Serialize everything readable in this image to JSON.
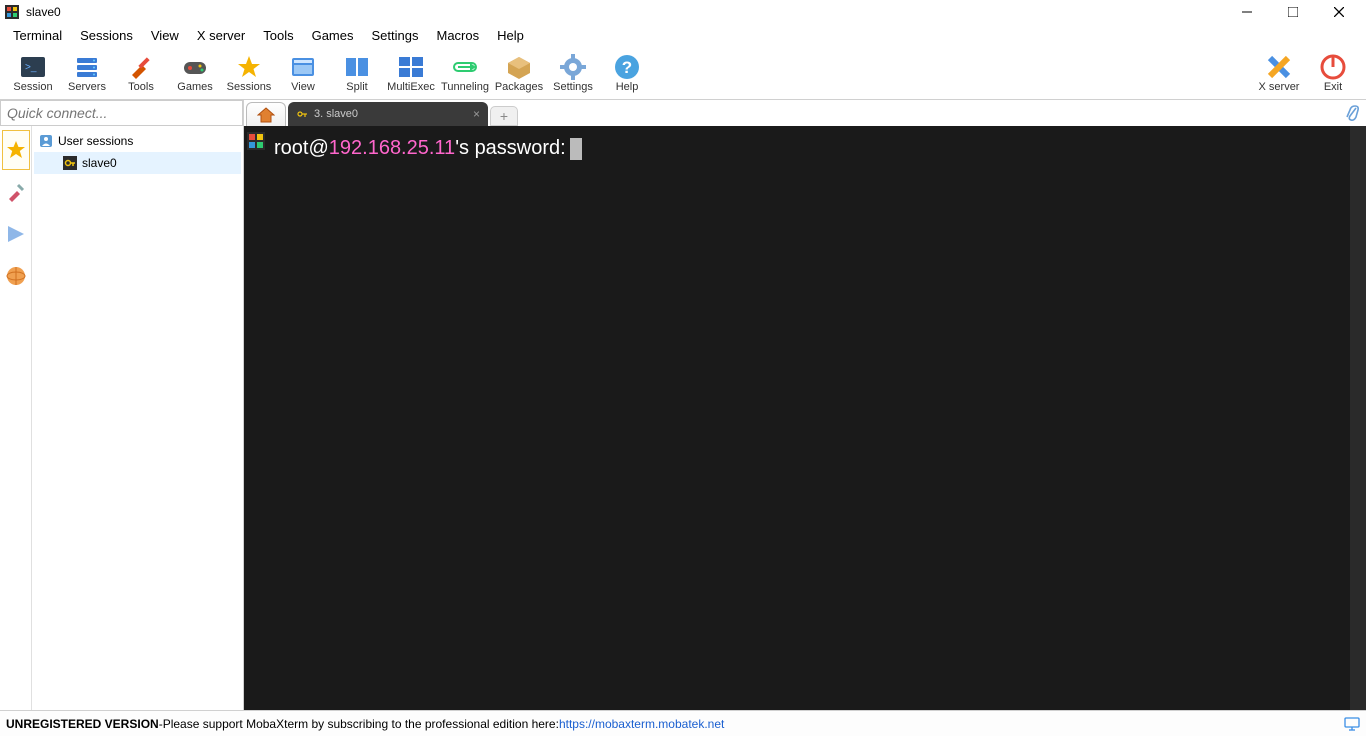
{
  "window": {
    "title": "slave0"
  },
  "menu": {
    "items": [
      "Terminal",
      "Sessions",
      "View",
      "X server",
      "Tools",
      "Games",
      "Settings",
      "Macros",
      "Help"
    ]
  },
  "toolbar": {
    "left": [
      {
        "label": "Session",
        "icon": "session"
      },
      {
        "label": "Servers",
        "icon": "servers"
      },
      {
        "label": "Tools",
        "icon": "tools"
      },
      {
        "label": "Games",
        "icon": "games"
      },
      {
        "label": "Sessions",
        "icon": "sessions"
      },
      {
        "label": "View",
        "icon": "view"
      },
      {
        "label": "Split",
        "icon": "split"
      },
      {
        "label": "MultiExec",
        "icon": "multiexec"
      },
      {
        "label": "Tunneling",
        "icon": "tunneling"
      },
      {
        "label": "Packages",
        "icon": "packages"
      },
      {
        "label": "Settings",
        "icon": "settings"
      },
      {
        "label": "Help",
        "icon": "help"
      }
    ],
    "right": [
      {
        "label": "X server",
        "icon": "xserver"
      },
      {
        "label": "Exit",
        "icon": "exit"
      }
    ]
  },
  "sidebar": {
    "quick_connect_placeholder": "Quick connect...",
    "tree": {
      "root_label": "User sessions",
      "items": [
        {
          "label": "slave0"
        }
      ]
    }
  },
  "tabs": {
    "session_tab_label": "3. slave0"
  },
  "terminal": {
    "prompt_user": "root@",
    "prompt_host": "192.168.25.11",
    "prompt_rest": "'s password:"
  },
  "status": {
    "unregistered": "UNREGISTERED VERSION",
    "sep": "  -  ",
    "msg": "Please support MobaXterm by subscribing to the professional edition here:  ",
    "link": "https://mobaxterm.mobatek.net"
  }
}
